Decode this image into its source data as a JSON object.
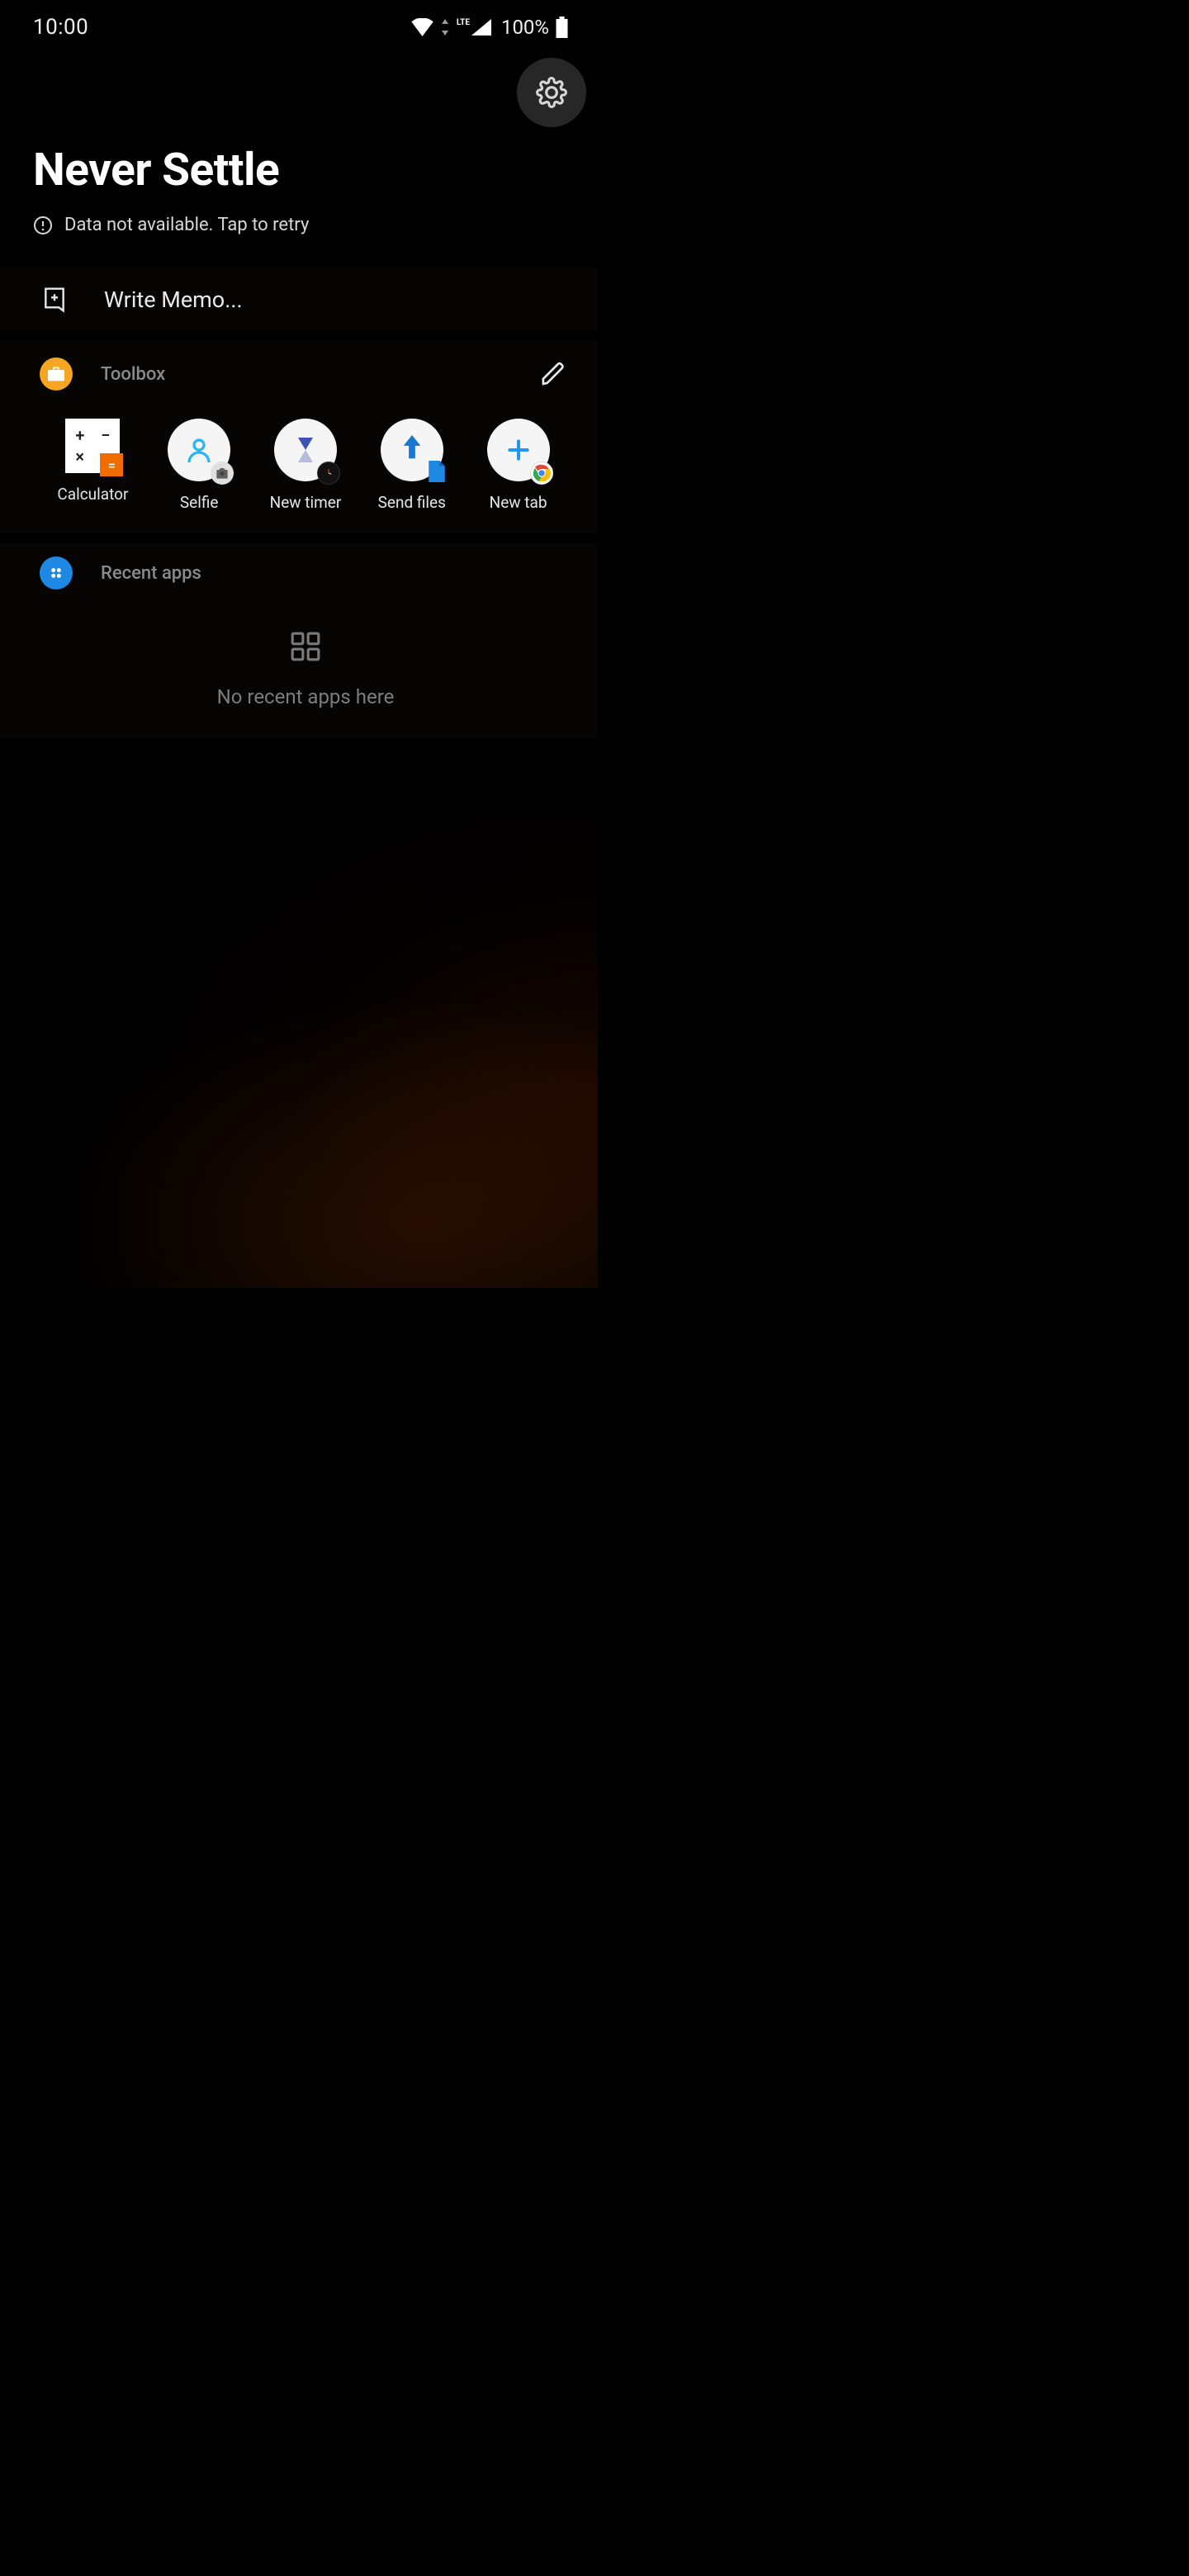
{
  "status": {
    "time": "10:00",
    "network_type": "LTE",
    "battery_pct": "100%"
  },
  "header": {
    "title": "Never Settle",
    "retry_text": "Data not available. Tap to retry"
  },
  "memo": {
    "placeholder": "Write Memo..."
  },
  "toolbox": {
    "title": "Toolbox",
    "items": [
      {
        "label": "Calculator"
      },
      {
        "label": "Selfie"
      },
      {
        "label": "New timer"
      },
      {
        "label": "Send files"
      },
      {
        "label": "New tab"
      }
    ]
  },
  "recent": {
    "title": "Recent apps",
    "empty_text": "No recent apps here"
  }
}
